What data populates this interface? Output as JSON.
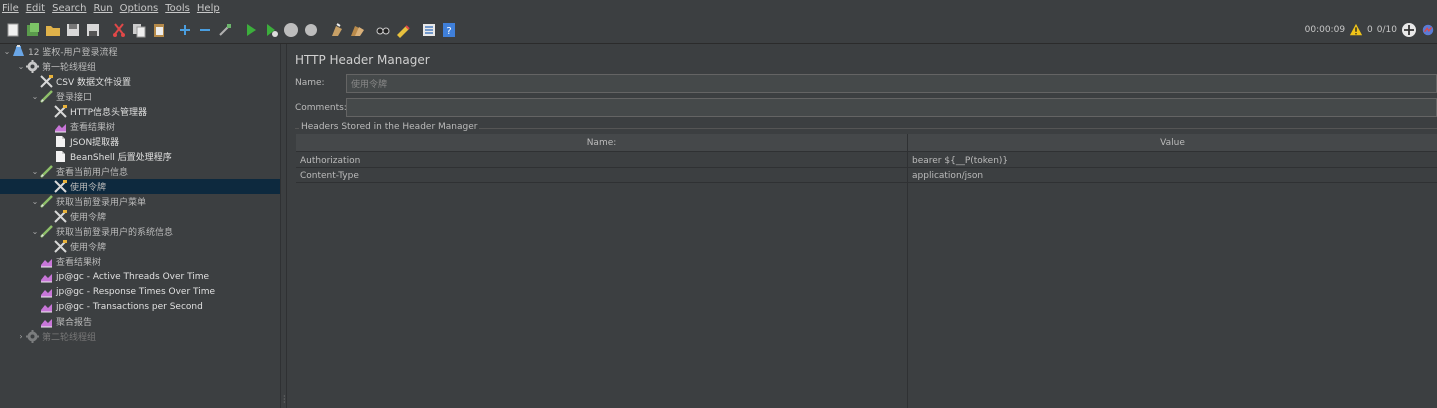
{
  "menu": [
    "File",
    "Edit",
    "Search",
    "Run",
    "Options",
    "Tools",
    "Help"
  ],
  "toolbar": {
    "icons": [
      "new-icon",
      "templates-icon",
      "open-icon",
      "save-icon",
      "save-as-icon",
      "cut-icon",
      "copy-icon",
      "paste-icon",
      "expand-icon",
      "collapse-icon",
      "toggle-icon",
      "start-icon",
      "start-no-pause-icon",
      "stop-icon",
      "shutdown-icon",
      "clear-icon",
      "clear-all-icon",
      "search-icon",
      "reset-search-icon",
      "function-helper-icon",
      "help-icon"
    ],
    "timer": "00:00:09",
    "warnings": "0",
    "threads": "0/10"
  },
  "tree": [
    {
      "label": "12 鉴权-用户登录流程",
      "icon": "test-plan-icon",
      "depth": 0,
      "expanded": true
    },
    {
      "label": "第一轮线程组",
      "icon": "thread-group-icon",
      "depth": 1,
      "expanded": true
    },
    {
      "label": "CSV 数据文件设置",
      "icon": "config-element-icon",
      "depth": 2
    },
    {
      "label": "登录接口",
      "icon": "sampler-icon",
      "depth": 2,
      "expanded": true
    },
    {
      "label": "HTTP信息头管理器",
      "icon": "config-element-icon",
      "depth": 3
    },
    {
      "label": "查看结果树",
      "icon": "listener-icon",
      "depth": 3
    },
    {
      "label": "JSON提取器",
      "icon": "post-processor-icon",
      "depth": 3
    },
    {
      "label": "BeanShell 后置处理程序",
      "icon": "post-processor-icon",
      "depth": 3
    },
    {
      "label": "查看当前用户信息",
      "icon": "sampler-icon",
      "depth": 2,
      "expanded": true
    },
    {
      "label": "使用令牌",
      "icon": "config-element-icon",
      "depth": 3,
      "selected": true
    },
    {
      "label": "获取当前登录用户菜单",
      "icon": "sampler-icon",
      "depth": 2,
      "expanded": true
    },
    {
      "label": "使用令牌",
      "icon": "config-element-icon",
      "depth": 3
    },
    {
      "label": "获取当前登录用户的系统信息",
      "icon": "sampler-icon",
      "depth": 2,
      "expanded": true
    },
    {
      "label": "使用令牌",
      "icon": "config-element-icon",
      "depth": 3
    },
    {
      "label": "查看结果树",
      "icon": "listener-icon",
      "depth": 2
    },
    {
      "label": "jp@gc - Active Threads Over Time",
      "icon": "listener-icon",
      "depth": 2
    },
    {
      "label": "jp@gc - Response Times Over Time",
      "icon": "listener-icon",
      "depth": 2
    },
    {
      "label": "jp@gc - Transactions per Second",
      "icon": "listener-icon",
      "depth": 2
    },
    {
      "label": "聚合报告",
      "icon": "listener-icon",
      "depth": 2
    },
    {
      "label": "第二轮线程组",
      "icon": "thread-group-icon",
      "depth": 1,
      "expanded": false,
      "disabled": true
    }
  ],
  "editor": {
    "title": "HTTP Header Manager",
    "name_label": "Name:",
    "name_value": "使用令牌",
    "comments_label": "Comments:",
    "comments_value": "",
    "group_title": "Headers Stored in the Header Manager",
    "columns": [
      "Name:",
      "Value"
    ],
    "rows": [
      {
        "name": "Authorization",
        "value": "bearer ${__P(token)}"
      },
      {
        "name": "Content-Type",
        "value": "application/json"
      }
    ]
  }
}
